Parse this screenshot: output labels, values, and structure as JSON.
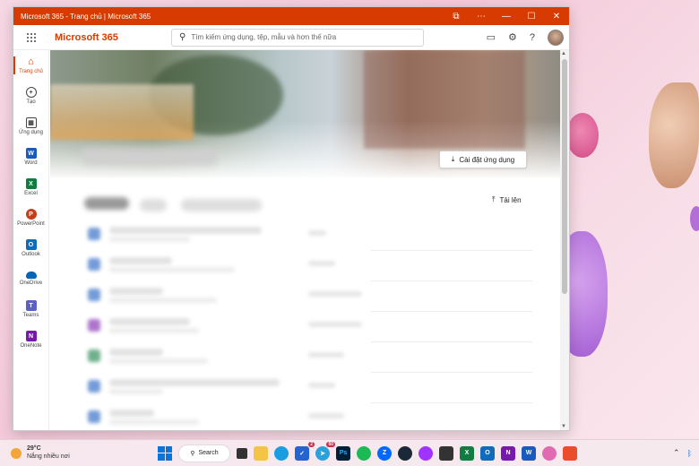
{
  "window": {
    "title": "Microsoft 365 - Trang chủ | Microsoft 365",
    "controls": [
      "⧉",
      "⋯",
      "—",
      "☐",
      "✕"
    ]
  },
  "appbar": {
    "brand": "Microsoft 365",
    "search_placeholder": "Tìm kiếm ứng dụng, tệp, mẫu và hơn thế nữa"
  },
  "rail": {
    "items": [
      {
        "label": "Trang chủ",
        "icon": "home-icon"
      },
      {
        "label": "Tạo",
        "icon": "plus-circle-icon"
      },
      {
        "label": "Ứng dụng",
        "icon": "apps-icon"
      },
      {
        "label": "Word",
        "icon": "word-icon"
      },
      {
        "label": "Excel",
        "icon": "excel-icon"
      },
      {
        "label": "PowerPoint",
        "icon": "powerpoint-icon"
      },
      {
        "label": "Outlook",
        "icon": "outlook-icon"
      },
      {
        "label": "OneDrive",
        "icon": "onedrive-icon"
      },
      {
        "label": "Teams",
        "icon": "teams-icon"
      },
      {
        "label": "OneNote",
        "icon": "onenote-icon"
      }
    ]
  },
  "main": {
    "install_label": "Cài đặt ứng dụng",
    "upload_label": "Tải lên"
  },
  "taskbar": {
    "weather_temp": "29°C",
    "weather_desc": "Nắng nhiều nơi",
    "search_label": "Search",
    "badges": {
      "edge_sync": "2",
      "telegram": "60"
    }
  },
  "colors": {
    "brand": "#d83b01",
    "word": "#185abd",
    "excel": "#107c41",
    "powerpoint": "#c43e1c",
    "outlook": "#0f6cbd",
    "onedrive": "#0364b8",
    "teams": "#5b5fc7",
    "onenote": "#7719aa"
  }
}
